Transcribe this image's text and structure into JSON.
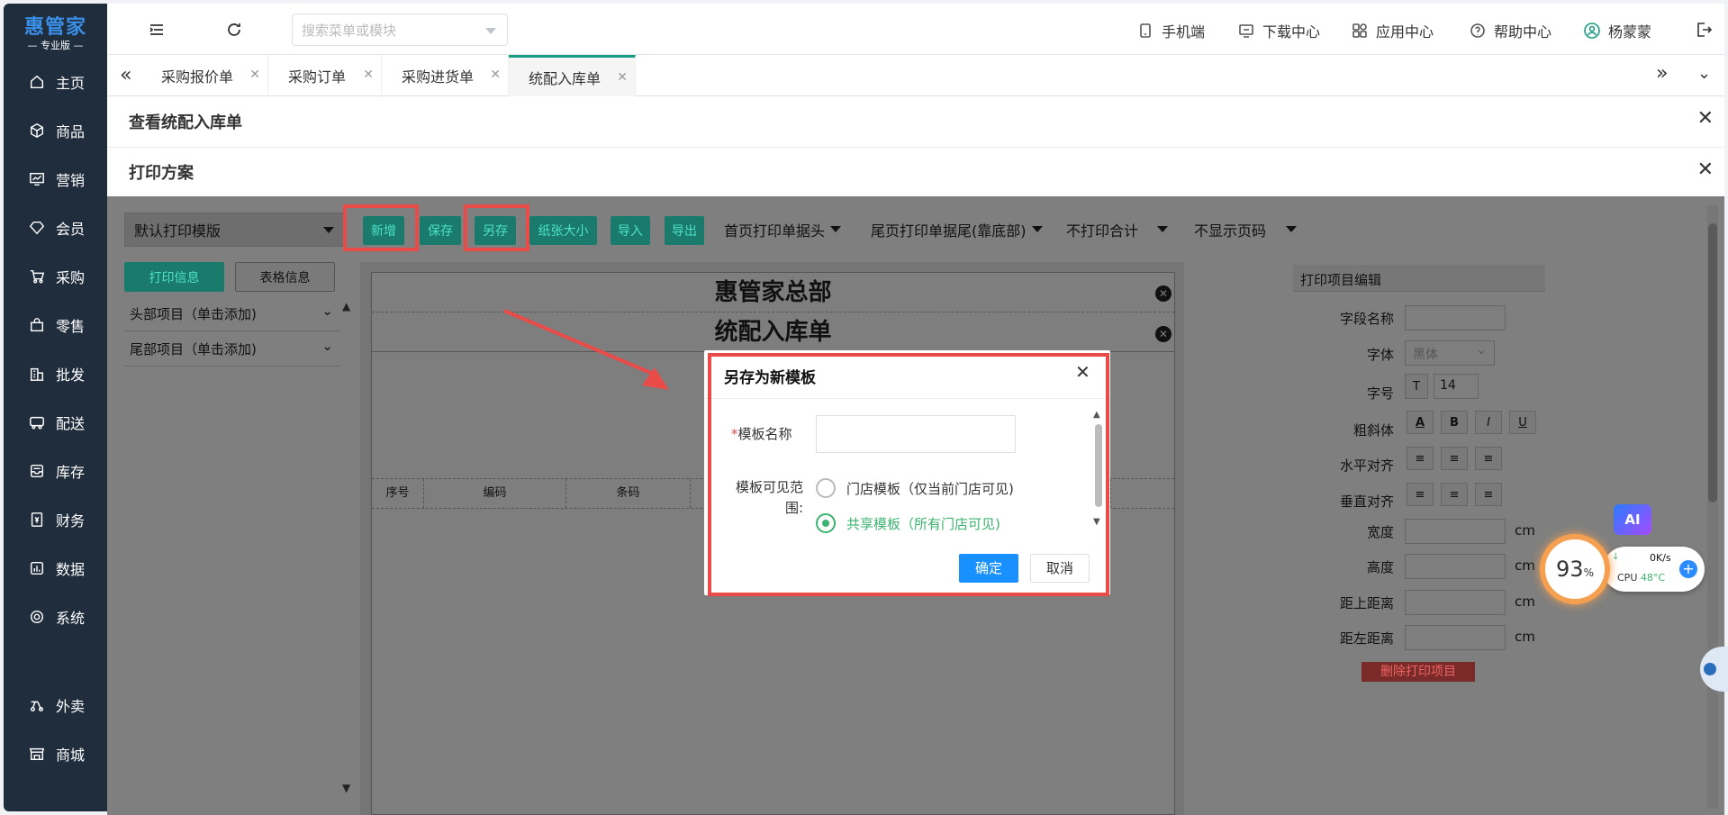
{
  "brand": {
    "name": "惠管家",
    "edition": "— 专业版 —"
  },
  "sidebar": {
    "items": [
      {
        "label": "主页",
        "icon": "home-icon"
      },
      {
        "label": "商品",
        "icon": "box-icon"
      },
      {
        "label": "营销",
        "icon": "monitor-icon"
      },
      {
        "label": "会员",
        "icon": "gem-icon"
      },
      {
        "label": "采购",
        "icon": "cart-icon"
      },
      {
        "label": "零售",
        "icon": "bag-icon"
      },
      {
        "label": "批发",
        "icon": "building-icon"
      },
      {
        "label": "配送",
        "icon": "truck-icon"
      },
      {
        "label": "库存",
        "icon": "inbox-icon"
      },
      {
        "label": "财务",
        "icon": "finance-icon"
      },
      {
        "label": "数据",
        "icon": "chart-icon"
      },
      {
        "label": "系统",
        "icon": "settings-icon"
      },
      {
        "label": "外卖",
        "icon": "scooter-icon"
      },
      {
        "label": "商城",
        "icon": "store-icon"
      }
    ]
  },
  "header": {
    "search_placeholder": "搜索菜单或模块",
    "links": [
      {
        "label": "手机端",
        "icon": "mobile-icon"
      },
      {
        "label": "下载中心",
        "icon": "download-icon"
      },
      {
        "label": "应用中心",
        "icon": "apps-icon"
      },
      {
        "label": "帮助中心",
        "icon": "help-icon"
      }
    ],
    "user": "杨蒙蒙"
  },
  "tabs": [
    {
      "label": "采购报价单",
      "active": false
    },
    {
      "label": "采购订单",
      "active": false
    },
    {
      "label": "采购进货单",
      "active": false
    },
    {
      "label": "统配入库单",
      "active": true
    }
  ],
  "panel_title": "查看统配入库单",
  "print_panel_title": "打印方案",
  "toolbar": {
    "template_select": "默认打印模版",
    "buttons": [
      "新增",
      "保存",
      "另存",
      "纸张大小",
      "导入",
      "导出"
    ],
    "dropdowns": [
      "首页打印单据头",
      "尾页打印单据尾(靠底部)",
      "不打印合计",
      "不显示页码"
    ]
  },
  "left_panel": {
    "tab_print_info": "打印信息",
    "tab_table_info": "表格信息",
    "head_items": "头部项目（单击添加)",
    "foot_items": "尾部项目（单击添加)"
  },
  "sheet": {
    "company": "惠管家总部",
    "doc_title": "统配入库单",
    "columns": [
      "序号",
      "编码",
      "条码"
    ]
  },
  "right_panel": {
    "title": "打印项目编辑",
    "fields": {
      "field_name": "字段名称",
      "font": "字体",
      "font_value": "黑体",
      "font_size": "字号",
      "font_size_value": "14",
      "style": "粗斜体",
      "h_align": "水平对齐",
      "v_align": "垂直对齐",
      "width": "宽度",
      "height": "高度",
      "top": "距上距离",
      "left": "距左距离",
      "unit": "cm"
    },
    "delete_button": "删除打印项目"
  },
  "modal": {
    "title": "另存为新模板",
    "name_label": "模板名称",
    "scope_label": "模板可见范围:",
    "options": [
      {
        "label": "门店模板（仅当前门店可见)",
        "selected": false
      },
      {
        "label": "共享模板（所有门店可见)",
        "selected": true
      }
    ],
    "confirm": "确定",
    "cancel": "取消"
  },
  "widget": {
    "percent": "93",
    "percent_unit": "%",
    "net": "0K/s",
    "cpu_label": "CPU",
    "cpu_temp": "48°C",
    "ai": "AI"
  },
  "colors": {
    "sidebar": "#1f2d3d",
    "accent": "#1a9b84",
    "highlight": "#e84b48",
    "primary_button": "#1890ff"
  }
}
